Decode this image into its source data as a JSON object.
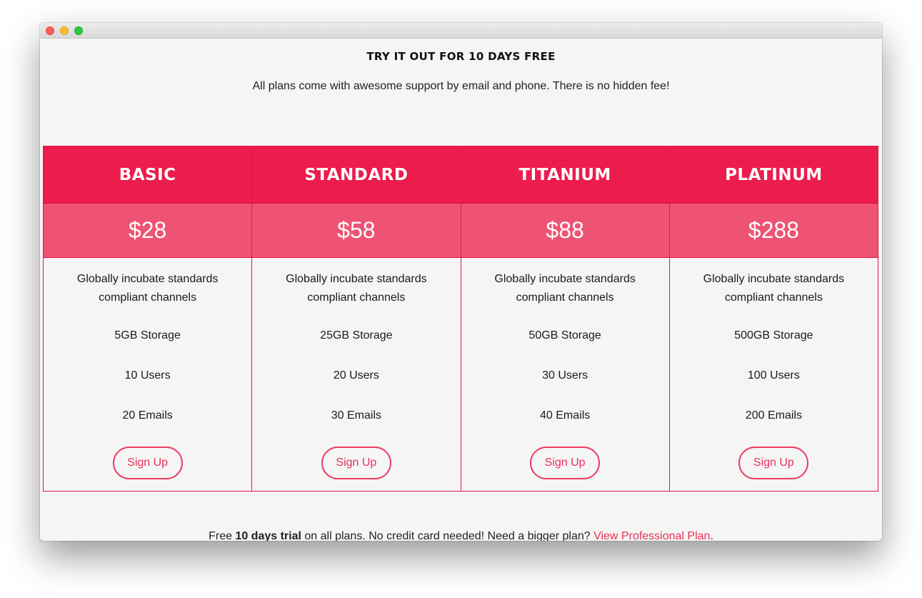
{
  "header": {
    "title": "TRY IT OUT FOR 10 DAYS FREE",
    "subtitle": "All plans come with awesome support by email and phone. There is no hidden fee!"
  },
  "plans": [
    {
      "name": "BASIC",
      "price": "$28",
      "description": "Globally incubate standards compliant channels",
      "storage": "5GB Storage",
      "users": "10 Users",
      "emails": "20 Emails",
      "cta": "Sign Up"
    },
    {
      "name": "STANDARD",
      "price": "$58",
      "description": "Globally incubate standards compliant channels",
      "storage": "25GB Storage",
      "users": "20 Users",
      "emails": "30 Emails",
      "cta": "Sign Up"
    },
    {
      "name": "TITANIUM",
      "price": "$88",
      "description": "Globally incubate standards compliant channels",
      "storage": "50GB Storage",
      "users": "30 Users",
      "emails": "40 Emails",
      "cta": "Sign Up"
    },
    {
      "name": "PLATINUM",
      "price": "$288",
      "description": "Globally incubate standards compliant channels",
      "storage": "500GB Storage",
      "users": "100 Users",
      "emails": "200 Emails",
      "cta": "Sign Up"
    }
  ],
  "footer": {
    "prefix": "Free ",
    "trial_bold": "10 days trial",
    "middle": " on all plans. No credit card needed! Need a bigger plan? ",
    "link_label": "View Professional Plan",
    "suffix": "."
  },
  "colors": {
    "accent": "#ec1c4c",
    "price_bg": "#ef5373",
    "link": "#e8305a"
  }
}
